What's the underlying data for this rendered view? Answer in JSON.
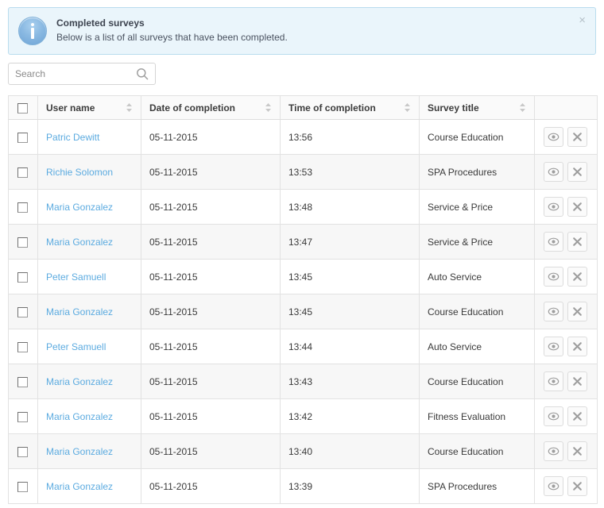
{
  "banner": {
    "title": "Completed surveys",
    "description": "Below is a list of all surveys that have been completed.",
    "close_label": "×",
    "icon": "info-circle-icon",
    "bg_color": "#eaf5fb",
    "border_color": "#b9dcee"
  },
  "search": {
    "value": "",
    "placeholder": "Search",
    "icon": "search-icon"
  },
  "table": {
    "select_all_checked": false,
    "columns": [
      {
        "key": "check",
        "label": "",
        "sortable": false
      },
      {
        "key": "name",
        "label": "User name",
        "sortable": true
      },
      {
        "key": "date",
        "label": "Date of completion",
        "sortable": true
      },
      {
        "key": "time",
        "label": "Time of completion",
        "sortable": true
      },
      {
        "key": "title",
        "label": "Survey title",
        "sortable": true
      },
      {
        "key": "act",
        "label": "",
        "sortable": false
      }
    ],
    "actions": {
      "view_label": "view-survey",
      "delete_label": "delete-survey"
    },
    "link_color": "#5cabe0",
    "rows": [
      {
        "name": "Patric Dewitt",
        "date": "05-11-2015",
        "time": "13:56",
        "title": "Course Education"
      },
      {
        "name": "Richie Solomon",
        "date": "05-11-2015",
        "time": "13:53",
        "title": "SPA Procedures"
      },
      {
        "name": "Maria Gonzalez",
        "date": "05-11-2015",
        "time": "13:48",
        "title": "Service & Price"
      },
      {
        "name": "Maria Gonzalez",
        "date": "05-11-2015",
        "time": "13:47",
        "title": "Service & Price"
      },
      {
        "name": "Peter Samuell",
        "date": "05-11-2015",
        "time": "13:45",
        "title": "Auto Service"
      },
      {
        "name": "Maria Gonzalez",
        "date": "05-11-2015",
        "time": "13:45",
        "title": "Course Education"
      },
      {
        "name": "Peter Samuell",
        "date": "05-11-2015",
        "time": "13:44",
        "title": "Auto Service"
      },
      {
        "name": "Maria Gonzalez",
        "date": "05-11-2015",
        "time": "13:43",
        "title": "Course Education"
      },
      {
        "name": "Maria Gonzalez",
        "date": "05-11-2015",
        "time": "13:42",
        "title": "Fitness Evaluation"
      },
      {
        "name": "Maria Gonzalez",
        "date": "05-11-2015",
        "time": "13:40",
        "title": "Course Education"
      },
      {
        "name": "Maria Gonzalez",
        "date": "05-11-2015",
        "time": "13:39",
        "title": "SPA Procedures"
      }
    ]
  }
}
